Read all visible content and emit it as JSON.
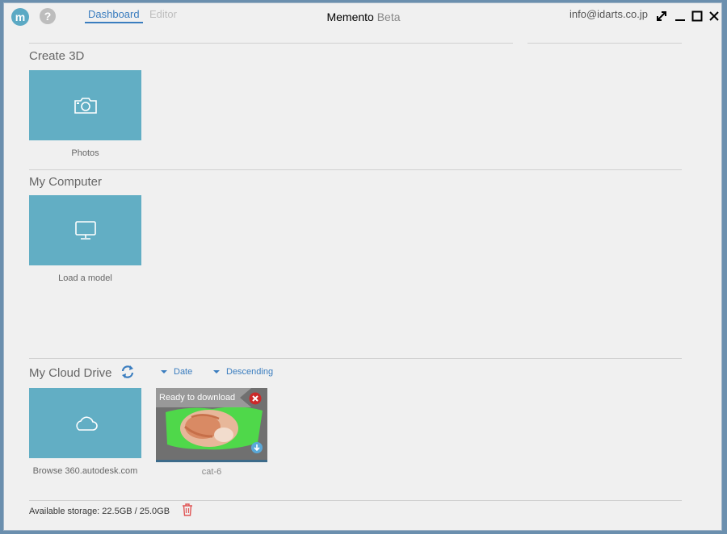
{
  "header": {
    "logo_letter": "m",
    "help_glyph": "?",
    "tabs": [
      {
        "label": "Dashboard",
        "active": true
      },
      {
        "label": "Editor",
        "active": false
      }
    ],
    "title_main": "Memento",
    "title_suffix": "Beta",
    "account_email": "info@idarts.co.jp",
    "window_controls": [
      "expand-icon",
      "minimize-icon",
      "maximize-icon",
      "close-icon"
    ]
  },
  "create3d": {
    "title": "Create 3D",
    "tile_label": "Photos",
    "tile_icon": "camera-icon"
  },
  "my_computer": {
    "title": "My Computer",
    "tile_label": "Load a model",
    "tile_icon": "monitor-icon"
  },
  "cloud_drive": {
    "title": "My Cloud Drive",
    "refresh_icon": "refresh-icon",
    "sort_field": "Date",
    "sort_order": "Descending",
    "browse_label": "Browse 360.autodesk.com",
    "browse_icon": "cloud-icon",
    "items": [
      {
        "name": "cat-6",
        "status": "Ready to download",
        "progress": 1.0
      }
    ]
  },
  "footer": {
    "storage_text": "Available storage: 22.5GB / 25.0GB",
    "trash_icon": "trash-icon"
  },
  "colors": {
    "tile": "#62aec4",
    "accent": "#3a7dbf",
    "background": "#f0f0f0",
    "delete": "#cc2a2a"
  }
}
